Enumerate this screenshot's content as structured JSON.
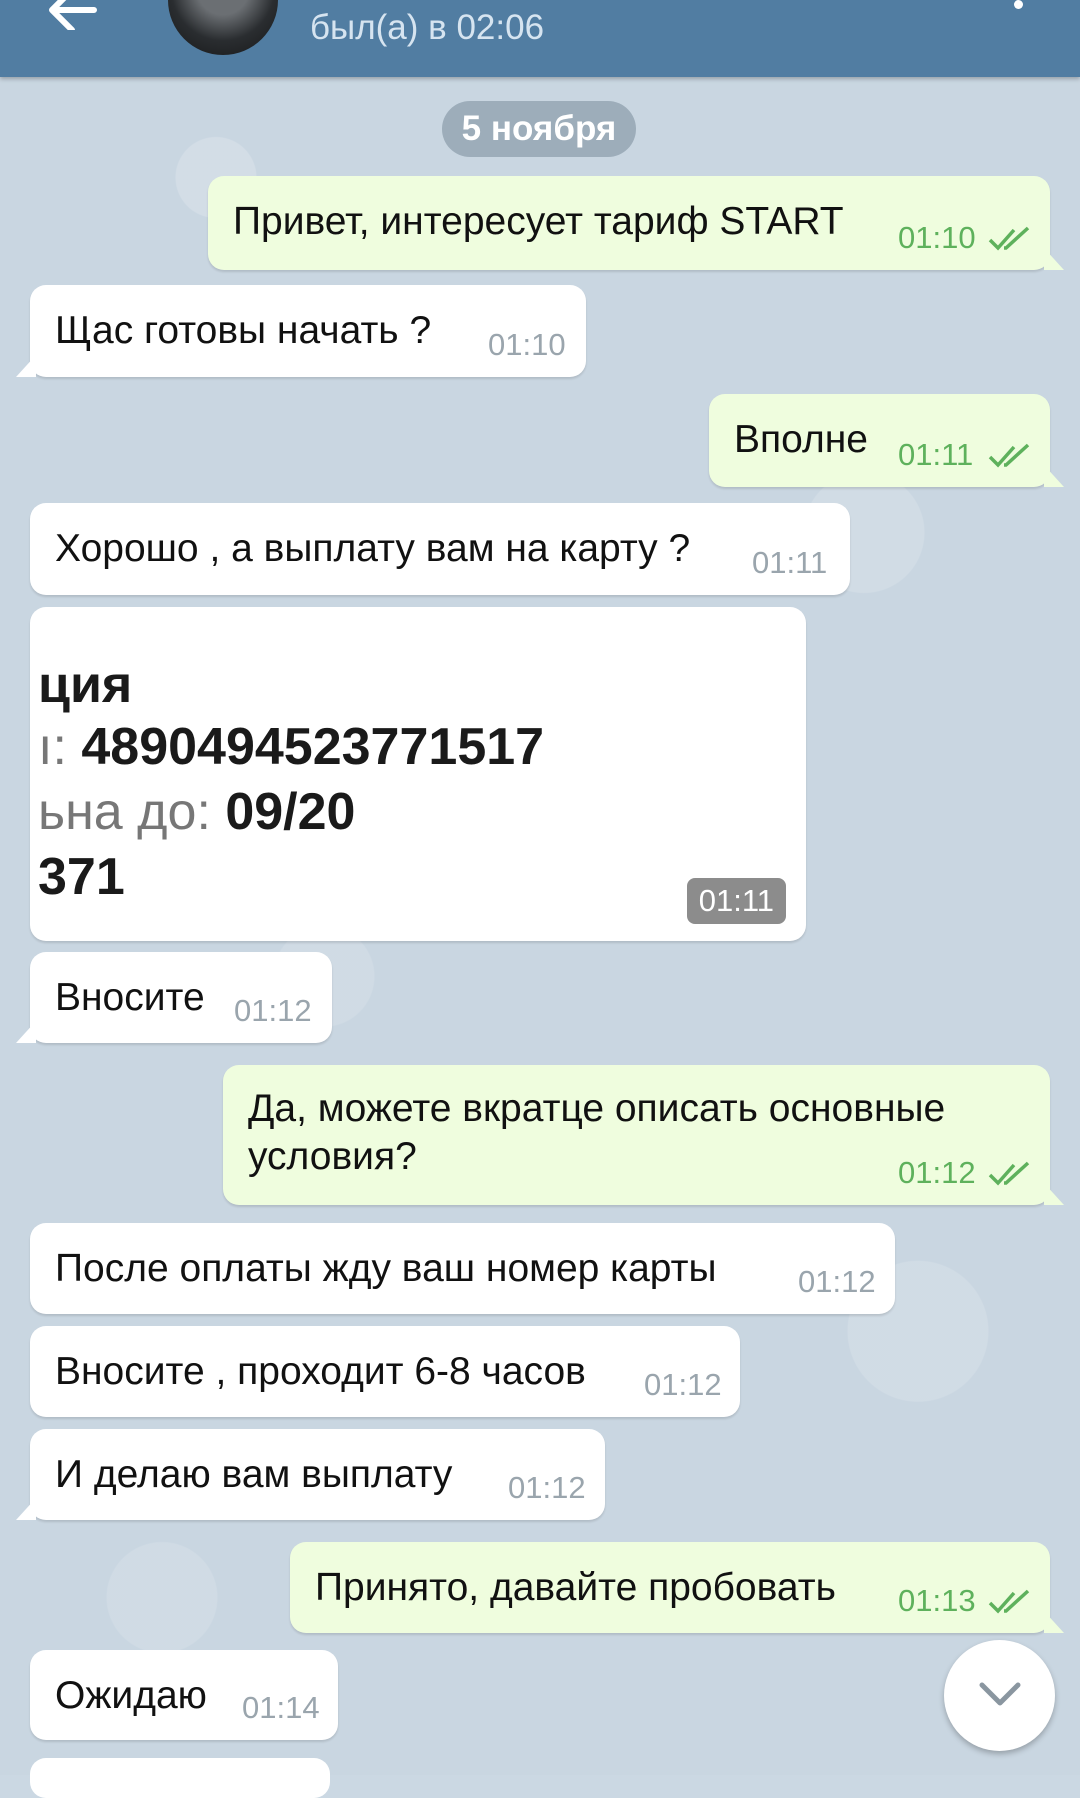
{
  "header": {
    "status": "был(а) в 02:06"
  },
  "date_separator": "5 ноября",
  "messages": [
    {
      "text": "Привет, интересует тариф START",
      "time": "01:10",
      "out": true
    },
    {
      "text": "Щас готовы начать ?",
      "time": "01:10",
      "out": false
    },
    {
      "text": "Вполне",
      "time": "01:11",
      "out": true
    },
    {
      "text": "Хорошо , а выплату вам на карту ?",
      "time": "01:11",
      "out": false
    },
    {
      "text": "Вносите",
      "time": "01:12",
      "out": false
    },
    {
      "text": "Да, можете вкратце описать основные условия?",
      "time": "01:12",
      "out": true
    },
    {
      "text": "После оплаты жду ваш номер карты",
      "time": "01:12",
      "out": false
    },
    {
      "text": "Вносите , проходит 6-8 часов",
      "time": "01:12",
      "out": false
    },
    {
      "text": "И делаю вам выплату",
      "time": "01:12",
      "out": false
    },
    {
      "text": "Принято, давайте пробовать",
      "time": "01:13",
      "out": true
    },
    {
      "text": "Ожидаю",
      "time": "01:14",
      "out": false
    }
  ],
  "photo": {
    "line1": "ция",
    "line2_prefix": "ı:",
    "line2_value": "4890494523771517",
    "line3_prefix": "ьна до:",
    "line3_value": "09/20",
    "line4": "371",
    "time": "01:11"
  },
  "colors": {
    "header": "#517da2",
    "outgoing": "#effdde",
    "incoming": "#ffffff",
    "check": "#5eb15c"
  }
}
